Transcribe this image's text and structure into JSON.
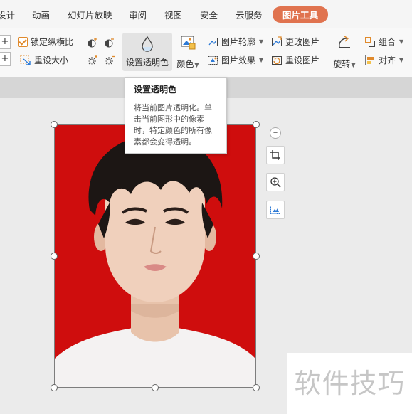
{
  "tabs": [
    {
      "label": "设计"
    },
    {
      "label": "动画"
    },
    {
      "label": "幻灯片放映"
    },
    {
      "label": "审阅"
    },
    {
      "label": "视图"
    },
    {
      "label": "安全"
    },
    {
      "label": "云服务"
    },
    {
      "label": "图片工具",
      "active": true
    }
  ],
  "ribbon": {
    "lock_ratio": "锁定纵横比",
    "lock_ratio_checked": true,
    "reset_size": "重设大小",
    "set_transparent": "设置透明色",
    "color": "颜色",
    "picture_outline": "图片轮廓",
    "picture_effects": "图片效果",
    "change_picture": "更改图片",
    "reset_picture": "重设图片",
    "rotate": "旋转",
    "group": "组合",
    "align": "对齐"
  },
  "tooltip": {
    "title": "设置透明色",
    "body": "将当前图片透明化。单击当前图形中的像素时，特定颜色的所有像素都会变得透明。"
  },
  "watermark": "软件技巧",
  "colors": {
    "accent": "#e0734f",
    "photo_background": "#cf0d0d"
  }
}
